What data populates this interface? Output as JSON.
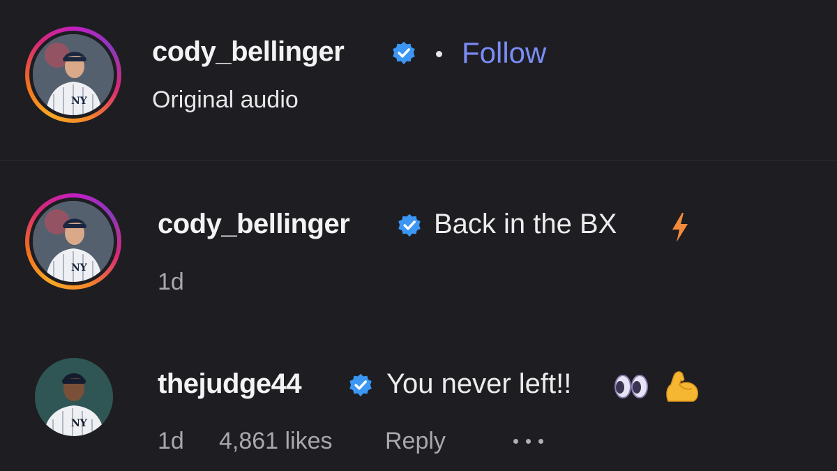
{
  "header": {
    "username": "cody_bellinger",
    "verified": true,
    "separator": "•",
    "follow_label": "Follow",
    "subtitle": "Original audio"
  },
  "comments": [
    {
      "username": "cody_bellinger",
      "verified": true,
      "text": "Back in the BX",
      "emoji": "lightning-bolt",
      "time": "1d"
    },
    {
      "username": "thejudge44",
      "verified": true,
      "text": "You never left!!",
      "emojis": [
        "eyes",
        "flexed-biceps"
      ],
      "time": "1d",
      "likes": "4,861 likes",
      "reply_label": "Reply"
    }
  ],
  "colors": {
    "background": "#1d1d22",
    "follow": "#7b8cf5",
    "verified": "#3b97f3",
    "meta": "#a8a8ad"
  }
}
